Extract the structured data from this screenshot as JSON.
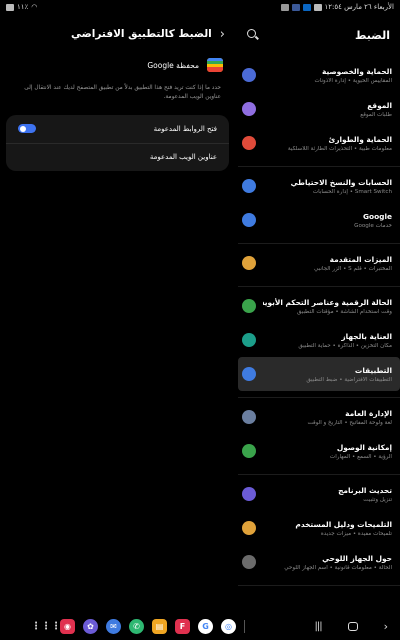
{
  "status_bar": {
    "left_text": "١١٪",
    "right_text": "الأربعاء ٢٦ مارس ١٢:٥٤"
  },
  "settings": {
    "title": "الضبط",
    "groups": [
      [
        {
          "title": "الحماية والخصوصية",
          "subtitle": "المقاييس الحيوية • إدارة الأذونات",
          "color": "#4b6bd6",
          "icon": "shield-icon"
        },
        {
          "title": "الموقع",
          "subtitle": "طلبات الموقع",
          "color": "#8f6ee0",
          "icon": "location-icon"
        },
        {
          "title": "الحماية والطوارئ",
          "subtitle": "معلومات طبية • التحذيرات الطارئة اللاسلكية",
          "color": "#e04b3a",
          "icon": "emergency-icon"
        }
      ],
      [
        {
          "title": "الحسابات والنسخ الاحتياطي",
          "subtitle": "Smart Switch • إدارة الحسابات",
          "color": "#3f7be0",
          "icon": "sync-icon"
        },
        {
          "title": "Google",
          "subtitle": "خدمات Google",
          "color": "#3f7be0",
          "icon": "google-icon"
        }
      ],
      [
        {
          "title": "الميزات المتقدمة",
          "subtitle": "المختبرات • قلم S • الزر الجانبي",
          "color": "#e0a23a",
          "icon": "advanced-features-icon"
        }
      ],
      [
        {
          "title": "الحالة الرقمية وعناصر التحكم الأبوية",
          "subtitle": "وقت استخدام الشاشة • مؤقتات التطبيق",
          "color": "#3aa34b",
          "icon": "digital-wellbeing-icon"
        },
        {
          "title": "العناية بالجهاز",
          "subtitle": "مكان التخزين • الذاكرة • حماية التطبيق",
          "color": "#1c9e8a",
          "icon": "device-care-icon"
        },
        {
          "title": "التطبيقات",
          "subtitle": "التطبيقات الافتراضية • ضبط التطبيق",
          "color": "#3f7be0",
          "icon": "apps-icon",
          "active": true
        }
      ],
      [
        {
          "title": "الإدارة العامة",
          "subtitle": "لغة ولوحة المفاتيح • التاريخ و الوقت",
          "color": "#6b7fa0",
          "icon": "general-management-icon"
        },
        {
          "title": "إمكانية الوصول",
          "subtitle": "الرؤية • السمع • المهارات",
          "color": "#3aa34b",
          "icon": "accessibility-icon"
        }
      ],
      [
        {
          "title": "تحديث البرنامج",
          "subtitle": "تنزيل وتثبيت",
          "color": "#6b5bd6",
          "icon": "software-update-icon"
        },
        {
          "title": "التلميحات ودليل المستخدم",
          "subtitle": "تلميحات مفيدة • ميزات جديدة",
          "color": "#e0a23a",
          "icon": "tips-icon"
        },
        {
          "title": "حول الجهاز اللوحي",
          "subtitle": "الحالة • معلومات قانونية • اسم الجهاز اللوحي",
          "color": "#6b6b6b",
          "icon": "about-icon"
        }
      ]
    ]
  },
  "default_app": {
    "title": "الضبط كالتطبيق الافتراضي",
    "app_name": "محفظة Google",
    "description": "حدد ما إذا كنت تريد فتح هذا التطبيق بدلاً من تطبيق المتصفح لديك عند الانتقال إلى عناوين الويب المدعومة.",
    "open_links_label": "فتح الروابط المدعومة",
    "open_links_enabled": true,
    "supported_urls_label": "عناوين الويب المدعومة"
  },
  "taskbar": {
    "apps": [
      {
        "name": "camera-app",
        "color": "#e0314f",
        "glyph": "◉",
        "shape": "square"
      },
      {
        "name": "gallery-app",
        "color": "#6b5bd6",
        "glyph": "✿",
        "shape": "round"
      },
      {
        "name": "messages-app",
        "color": "#3f7be0",
        "glyph": "✉",
        "shape": "round"
      },
      {
        "name": "phone-app",
        "color": "#2eb872",
        "glyph": "✆",
        "shape": "round"
      },
      {
        "name": "notes-app",
        "color": "#f0a623",
        "glyph": "▤",
        "shape": "square"
      },
      {
        "name": "flipboard-app",
        "color": "#e0314f",
        "glyph": "F",
        "shape": "square"
      },
      {
        "name": "google-app",
        "color": "#ffffff",
        "glyph": "G",
        "shape": "round"
      },
      {
        "name": "chrome-app",
        "color": "#ffffff",
        "glyph": "◎",
        "shape": "round"
      }
    ]
  }
}
